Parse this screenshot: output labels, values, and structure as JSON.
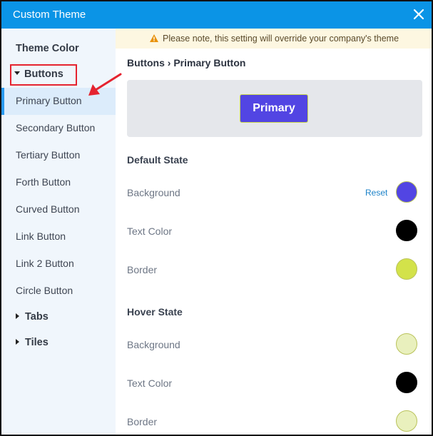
{
  "window": {
    "title": "Custom Theme",
    "close_icon": "close-icon"
  },
  "notice": {
    "text": "Please note, this setting will override your company's theme",
    "icon": "warning-icon"
  },
  "sidebar": {
    "heading": "Theme Color",
    "groups": {
      "buttons": "Buttons",
      "tabs": "Tabs",
      "tiles": "Tiles"
    },
    "items": [
      {
        "label": "Primary Button",
        "active": true
      },
      {
        "label": "Secondary Button"
      },
      {
        "label": "Tertiary Button"
      },
      {
        "label": "Forth Button"
      },
      {
        "label": "Curved Button"
      },
      {
        "label": "Link Button"
      },
      {
        "label": "Link 2 Button"
      },
      {
        "label": "Circle Button"
      }
    ]
  },
  "main": {
    "breadcrumb": "Buttons › Primary Button",
    "preview_button": "Primary",
    "default_state": {
      "title": "Default State",
      "background": {
        "label": "Background",
        "color": "#5245e3",
        "reset": "Reset"
      },
      "text_color": {
        "label": "Text Color",
        "color": "#000000"
      },
      "border": {
        "label": "Border",
        "color": "#d3e24a"
      }
    },
    "hover_state": {
      "title": "Hover State",
      "background": {
        "label": "Background",
        "color": "#e9f0bd"
      },
      "text_color": {
        "label": "Text Color",
        "color": "#000000"
      },
      "border": {
        "label": "Border",
        "color": "#e9f0bd"
      }
    }
  },
  "colors": {
    "titlebar": "#0b94e6",
    "accent": "#2a9af0",
    "annotation": "#e5232f"
  }
}
